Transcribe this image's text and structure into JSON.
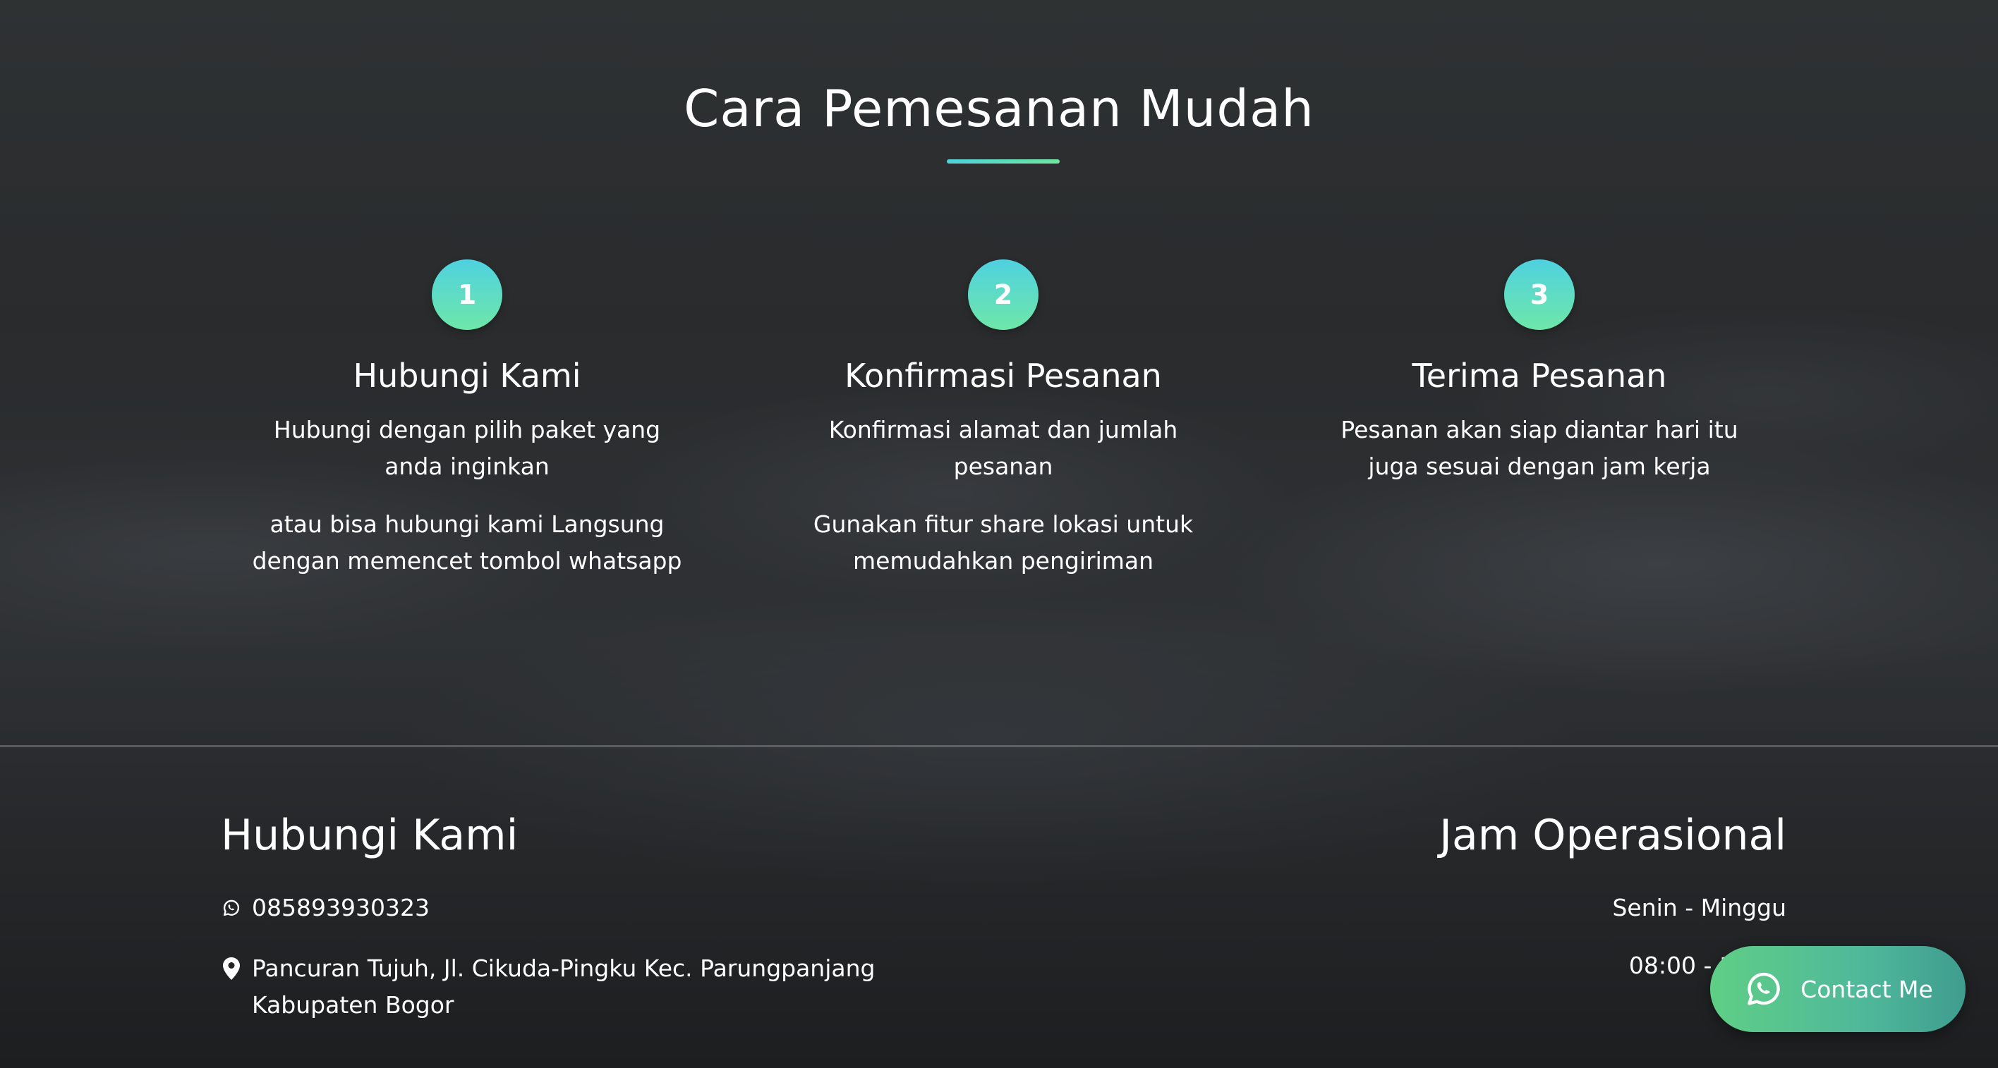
{
  "section": {
    "title": "Cara Pemesanan Mudah"
  },
  "steps": [
    {
      "number": "1",
      "title": "Hubungi Kami",
      "paragraphs": [
        "Hubungi dengan pilih paket yang anda inginkan",
        "atau bisa hubungi kami Langsung dengan memencet tombol whatsapp"
      ]
    },
    {
      "number": "2",
      "title": "Konfirmasi Pesanan",
      "paragraphs": [
        "Konfirmasi alamat dan jumlah pesanan",
        "Gunakan fitur share lokasi untuk memudahkan pengiriman"
      ]
    },
    {
      "number": "3",
      "title": "Terima Pesanan",
      "paragraphs": [
        "Pesanan akan siap diantar hari itu juga sesuai dengan jam kerja"
      ]
    }
  ],
  "footer": {
    "contact": {
      "heading": "Hubungi Kami",
      "phone": "085893930323",
      "phone_icon": "whatsapp-icon",
      "address": "Pancuran Tujuh, Jl. Cikuda-Pingku Kec. Parungpanjang Kabupaten Bogor",
      "address_icon": "map-marker-icon"
    },
    "hours": {
      "heading": "Jam Operasional",
      "days": "Senin - Minggu",
      "time": "08:00 - 17:00"
    }
  },
  "contact_button": {
    "label": "Contact Me",
    "icon": "whatsapp-icon"
  },
  "colors": {
    "badge_gradient_start": "#4fd1e0",
    "badge_gradient_end": "#6ee7a8",
    "button_gradient_start": "#5fcf86",
    "button_gradient_end": "#3f9d8f"
  }
}
